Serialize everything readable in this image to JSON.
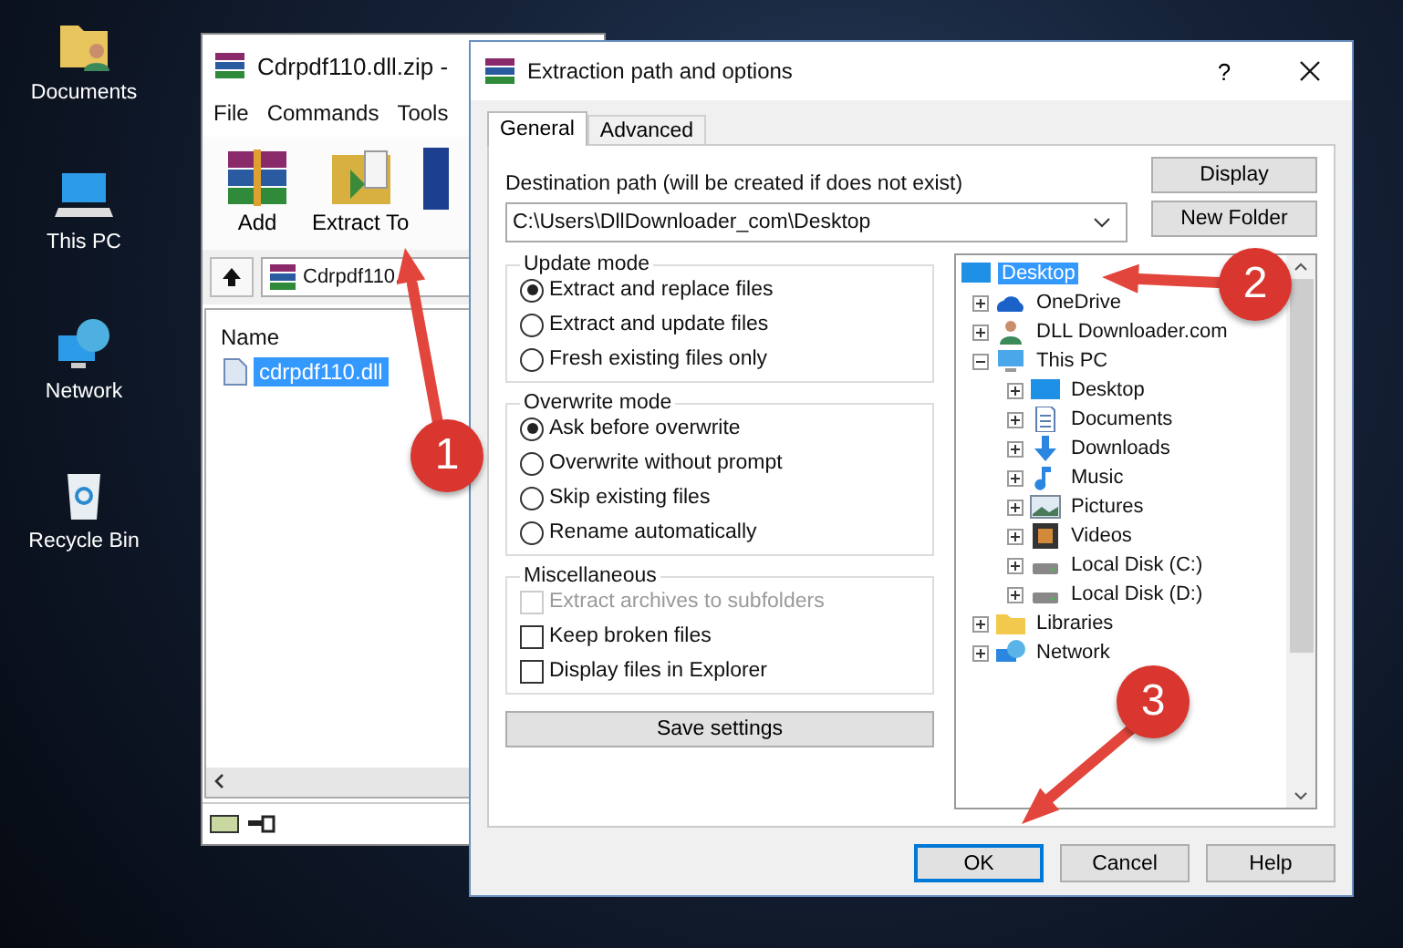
{
  "desktop_icons": [
    {
      "label": "Documents",
      "kind": "user-folder"
    },
    {
      "label": "This PC",
      "kind": "computer"
    },
    {
      "label": "Network",
      "kind": "network"
    },
    {
      "label": "Recycle Bin",
      "kind": "recycle"
    }
  ],
  "archiver": {
    "title": "Cdrpdf110.dll.zip -",
    "menu": [
      "File",
      "Commands",
      "Tools"
    ],
    "toolbar": [
      {
        "label": "Add",
        "kind": "add"
      },
      {
        "label": "Extract To",
        "kind": "extract"
      }
    ],
    "path": "Cdrpdf110.",
    "column": "Name",
    "files": [
      {
        "name": "cdrpdf110.dll",
        "selected": true
      }
    ]
  },
  "dialog": {
    "title": "Extraction path and options",
    "help": "?",
    "tabs": [
      {
        "label": "General",
        "selected": true
      },
      {
        "label": "Advanced",
        "selected": false
      }
    ],
    "destination_label": "Destination path (will be created if does not exist)",
    "destination": "C:\\Users\\DllDownloader_com\\Desktop",
    "side_buttons": [
      "Display",
      "New Folder"
    ],
    "groups": [
      {
        "title": "Update mode",
        "kind": "radio",
        "options": [
          {
            "label": "Extract and replace files",
            "selected": true,
            "disabled": false
          },
          {
            "label": "Extract and update files",
            "selected": false,
            "disabled": false
          },
          {
            "label": "Fresh existing files only",
            "selected": false,
            "disabled": false
          }
        ]
      },
      {
        "title": "Overwrite mode",
        "kind": "radio",
        "options": [
          {
            "label": "Ask before overwrite",
            "selected": true,
            "disabled": false
          },
          {
            "label": "Overwrite without prompt",
            "selected": false,
            "disabled": false
          },
          {
            "label": "Skip existing files",
            "selected": false,
            "disabled": false
          },
          {
            "label": "Rename automatically",
            "selected": false,
            "disabled": false
          }
        ]
      },
      {
        "title": "Miscellaneous",
        "kind": "check",
        "options": [
          {
            "label": "Extract archives to subfolders",
            "checked": false,
            "disabled": true
          },
          {
            "label": "Keep broken files",
            "checked": false,
            "disabled": false
          },
          {
            "label": "Display files in Explorer",
            "checked": false,
            "disabled": false
          }
        ]
      }
    ],
    "save_button": "Save settings",
    "tree": [
      {
        "label": "Desktop",
        "kind": "desktop",
        "selected": true,
        "children": [
          {
            "label": "OneDrive",
            "kind": "cloud",
            "selected": false,
            "expanded": false
          },
          {
            "label": "DLL Downloader.com",
            "kind": "user",
            "selected": false,
            "expanded": false
          },
          {
            "label": "This PC",
            "kind": "computer",
            "selected": false,
            "expanded": true,
            "children": [
              {
                "label": "Desktop",
                "kind": "desktop",
                "selected": false,
                "expanded": false
              },
              {
                "label": "Documents",
                "kind": "document",
                "selected": false,
                "expanded": false
              },
              {
                "label": "Downloads",
                "kind": "download",
                "selected": false,
                "expanded": false
              },
              {
                "label": "Music",
                "kind": "music",
                "selected": false,
                "expanded": false
              },
              {
                "label": "Pictures",
                "kind": "picture",
                "selected": false,
                "expanded": false
              },
              {
                "label": "Videos",
                "kind": "video",
                "selected": false,
                "expanded": false
              },
              {
                "label": "Local Disk (C:)",
                "kind": "disk",
                "selected": false,
                "expanded": false
              },
              {
                "label": "Local Disk (D:)",
                "kind": "disk",
                "selected": false,
                "expanded": false
              }
            ]
          },
          {
            "label": "Libraries",
            "kind": "folder",
            "selected": false,
            "expanded": false
          },
          {
            "label": "Network",
            "kind": "network",
            "selected": false,
            "expanded": false
          }
        ]
      }
    ],
    "buttons": [
      {
        "label": "OK",
        "default": true
      },
      {
        "label": "Cancel",
        "default": false
      },
      {
        "label": "Help",
        "default": false
      }
    ]
  },
  "annotations": [
    "1",
    "2",
    "3"
  ]
}
